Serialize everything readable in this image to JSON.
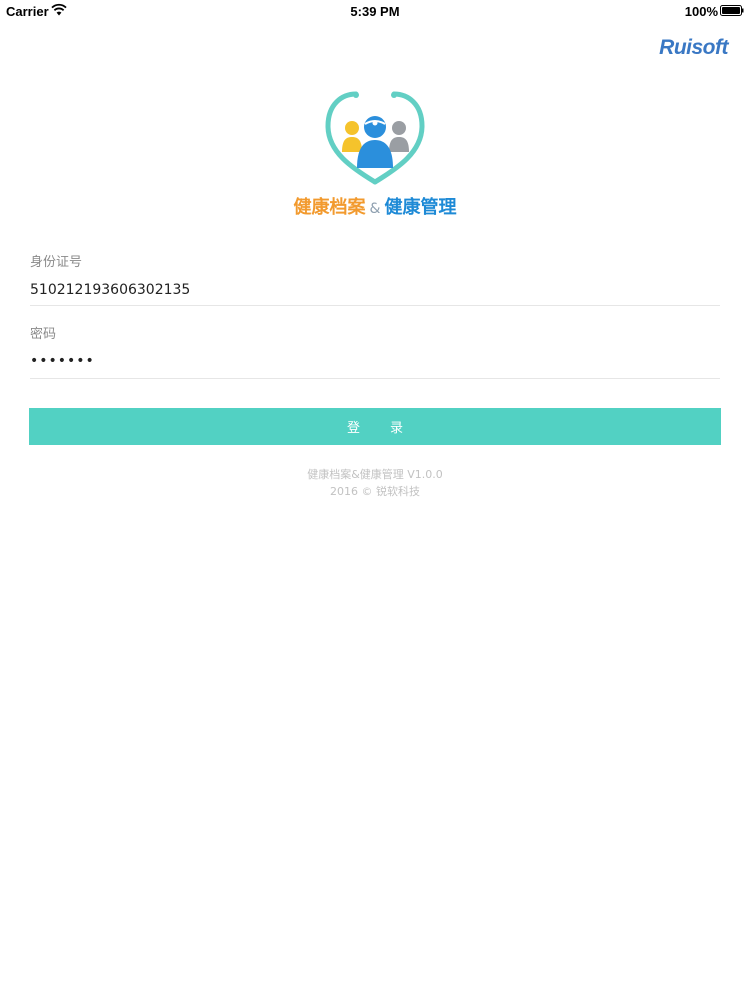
{
  "status_bar": {
    "carrier": "Carrier",
    "time": "5:39 PM",
    "battery": "100%",
    "wifi_icon": "wifi-icon",
    "battery_icon": "battery-full-icon"
  },
  "brand": {
    "name": "Ruisoft",
    "color": "#3a78c4"
  },
  "logo": {
    "icon": "health-family-stethoscope-logo"
  },
  "app_title": {
    "left": "健康档案",
    "separator": "&",
    "right": "健康管理"
  },
  "form": {
    "id_label": "身份证号",
    "id_value": "510212193606302135",
    "password_label": "密码",
    "password_masked": "•••••••",
    "login_label": "登录"
  },
  "footer": {
    "version_line": "健康档案&健康管理 V1.0.0",
    "copyright_line": "2016 © 锐软科技"
  },
  "colors": {
    "accent": "#52d1c3",
    "title_orange": "#f29a2e",
    "title_blue": "#1e8ad6"
  }
}
